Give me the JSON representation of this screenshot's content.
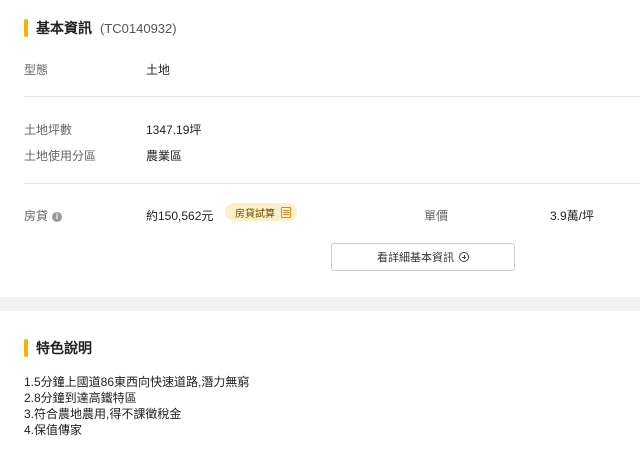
{
  "basic_info": {
    "title": "基本資訊",
    "code": "(TC0140932)",
    "rows": [
      {
        "label": "型態",
        "value": "土地"
      },
      {
        "label": "土地坪數",
        "value": "1347.19坪"
      },
      {
        "label": "土地使用分區",
        "value": "農業區"
      }
    ],
    "loan": {
      "label": "房貸",
      "value": "約150,562元",
      "calc_button": "房貸試算"
    },
    "unit_price": {
      "label": "單價",
      "value": "3.9萬/坪"
    },
    "detail_button": "看詳細基本資訊"
  },
  "features": {
    "title": "特色說明",
    "lines": [
      "1.5分鐘上國道86東西向快速道路,潛力無窮",
      "2.8分鐘到達高鐵特區",
      "3.符合農地農用,得不課徵稅金",
      "4.保值傳家"
    ]
  },
  "colors": {
    "accent": "#f5b400",
    "loan_badge_bg": "#fdf0c8",
    "section_gap": "#f2f2f2"
  }
}
